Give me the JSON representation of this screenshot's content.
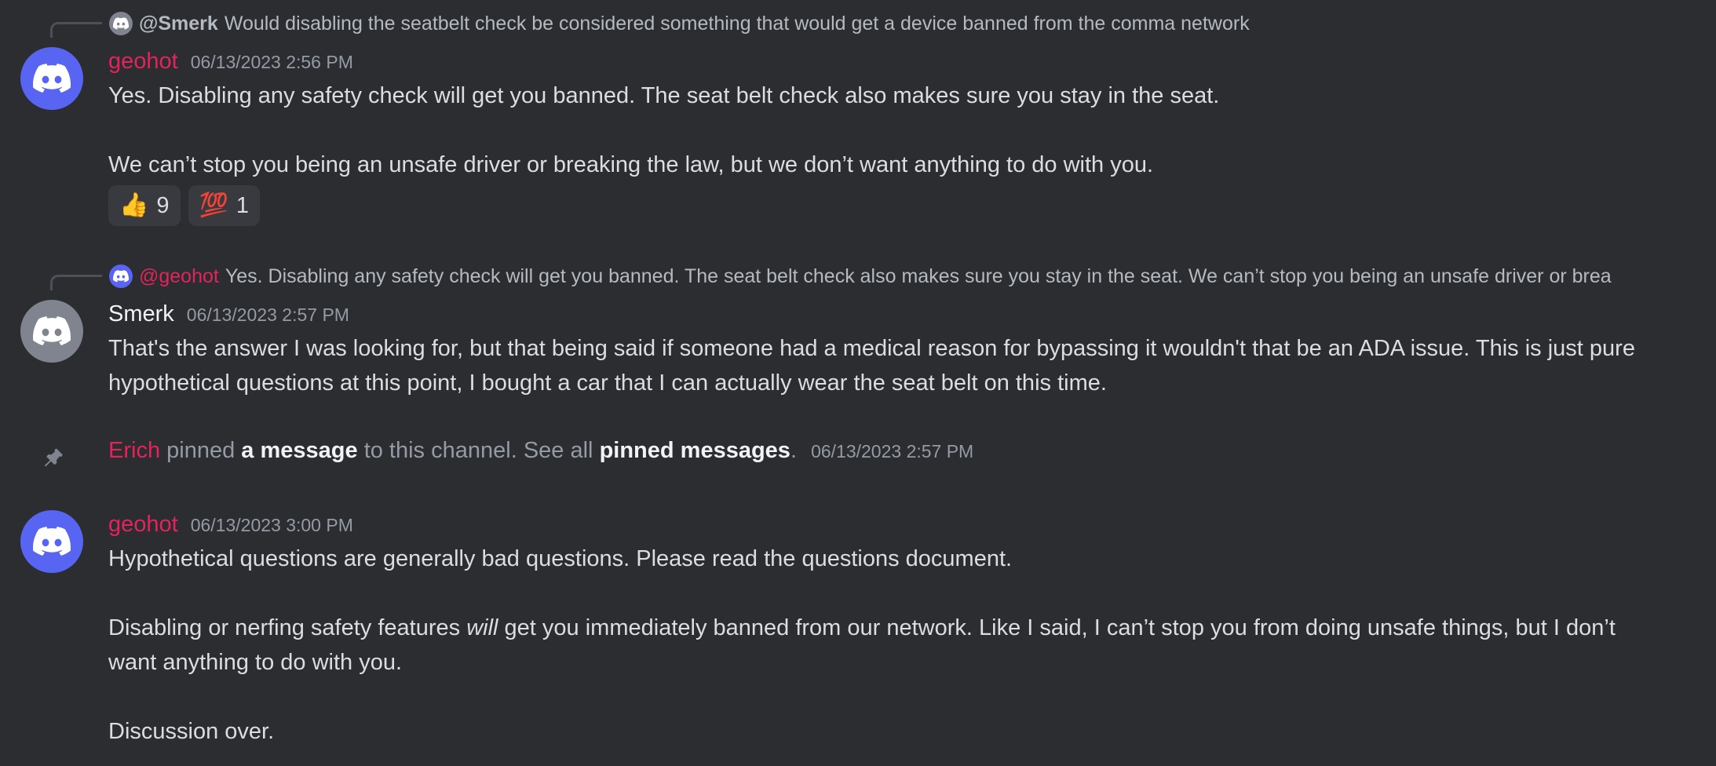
{
  "messages": [
    {
      "reply": {
        "mention": "@Smerk",
        "text": "Would disabling the seatbelt check be considered something that would get a device banned from the comma network"
      },
      "author": "geohot",
      "timestamp": "06/13/2023 2:56 PM",
      "paragraphs": [
        "Yes. Disabling any safety check will get you banned. The seat belt check also makes sure you stay in the seat.",
        "We can’t stop you being an unsafe driver or breaking the law, but we don’t want anything to do with you."
      ],
      "reactions": [
        {
          "emoji": "👍",
          "count": "9"
        },
        {
          "emoji": "💯",
          "count": "1"
        }
      ]
    },
    {
      "reply": {
        "mention": "@geohot",
        "text": "Yes. Disabling any safety check will get you banned. The seat belt check also makes sure you stay in the seat. We can’t stop you being an unsafe driver or brea"
      },
      "author": "Smerk",
      "timestamp": "06/13/2023 2:57 PM",
      "paragraphs": [
        "That's the answer I was looking for, but that being said if someone had a medical reason for bypassing it wouldn't that be an ADA issue. This is just pure hypothetical questions at this point, I bought a car that I can actually wear the seat belt on this time."
      ]
    },
    {
      "author": "geohot",
      "timestamp": "06/13/2023 3:00 PM",
      "paragraphs": [
        "Hypothetical questions are generally bad questions. Please read the questions document.",
        "Disabling or nerfing safety features",
        "will",
        "get you immediately banned from our network. Like I said, I can’t stop you from doing unsafe things, but I don’t want anything to do with you.",
        "Discussion over."
      ]
    }
  ],
  "system": {
    "actor": "Erich",
    "verb": "pinned",
    "link1": "a message",
    "middle": "to this channel. See all",
    "link2": "pinned messages",
    "end": ".",
    "timestamp": "06/13/2023 2:57 PM"
  },
  "colors": {
    "background": "#2b2d31",
    "blurple": "#5865f2",
    "role_red": "#e3245a",
    "muted": "#949ba4",
    "text": "#dbdee1"
  },
  "icons": [
    "discord-logo-icon",
    "pin-icon"
  ]
}
